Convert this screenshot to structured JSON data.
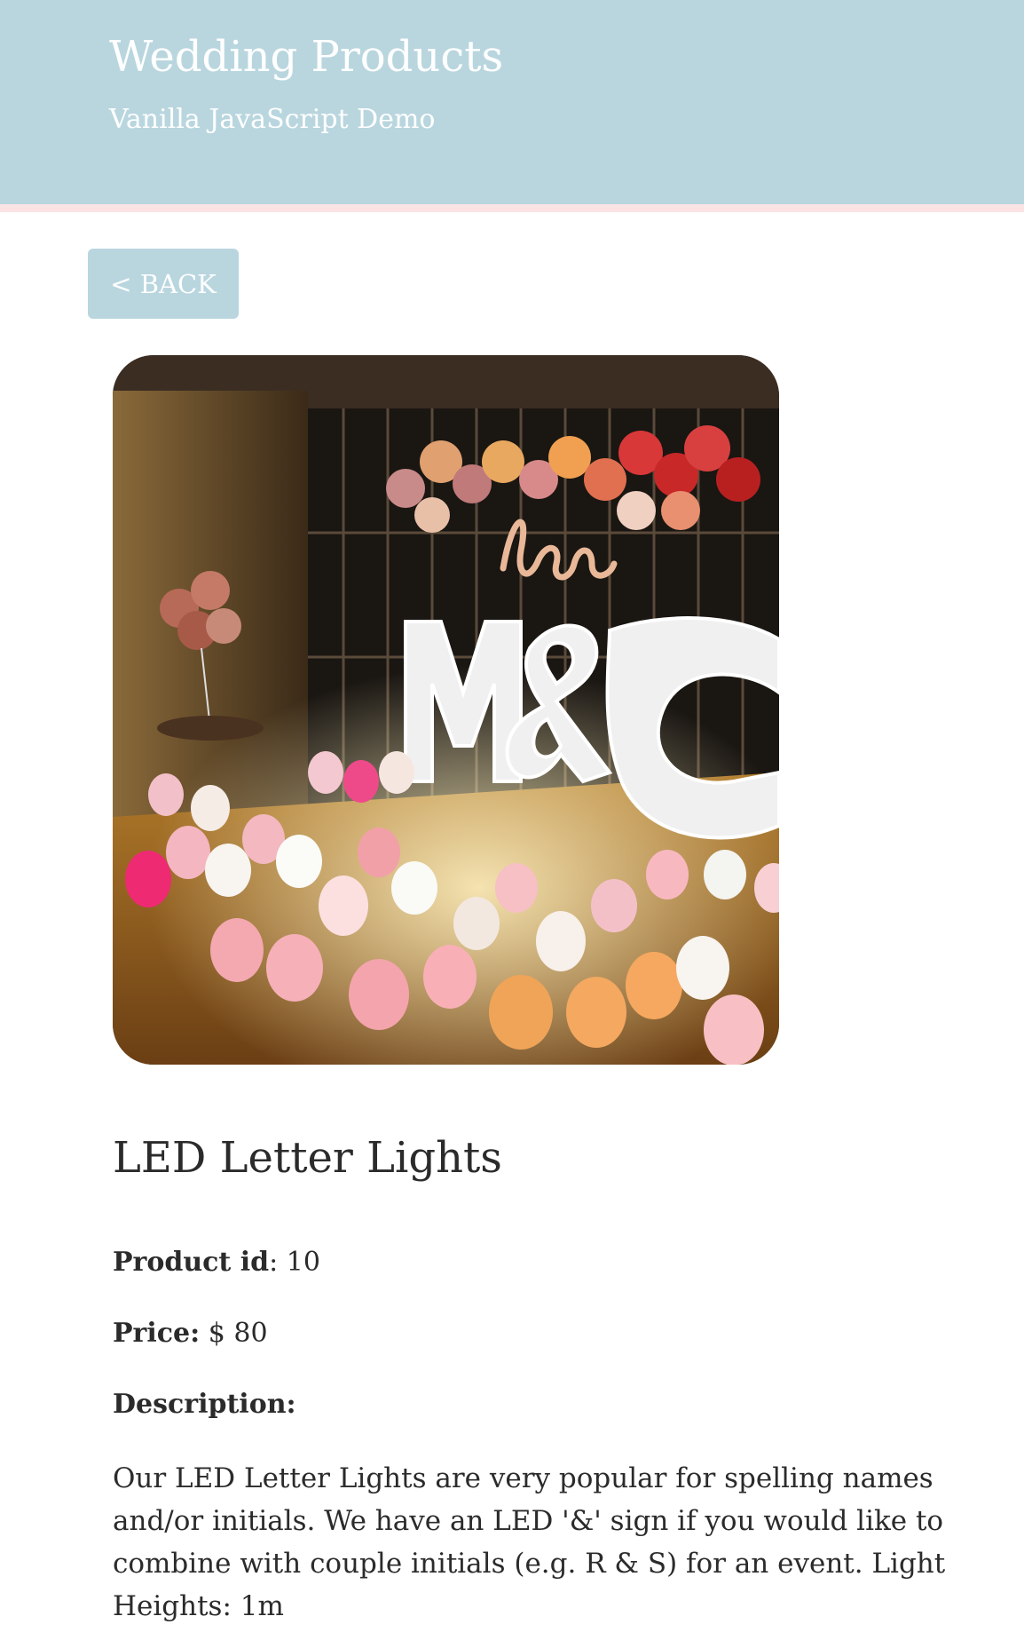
{
  "header": {
    "title": "Wedding Products",
    "subtitle": "Vanilla JavaScript Demo"
  },
  "back_button": {
    "label": "< BACK"
  },
  "product": {
    "image_icon": "led-letter-lights-photo",
    "title": "LED Letter Lights",
    "id_label": "Product id",
    "id_value": ": 10",
    "price_label": "Price:",
    "price_value": " $ 80",
    "description_label": "Description:",
    "description": "Our LED Letter Lights are very popular for spelling names and/or initials. We have an LED '&' sign if you would like to combine with couple initials (e.g. R & S) for an event. Light Heights: 1m"
  },
  "colors": {
    "header_bg": "#b9d6df",
    "header_border": "#fbe3e3",
    "button_bg": "#b9d6df",
    "text": "#2b2b2b"
  }
}
